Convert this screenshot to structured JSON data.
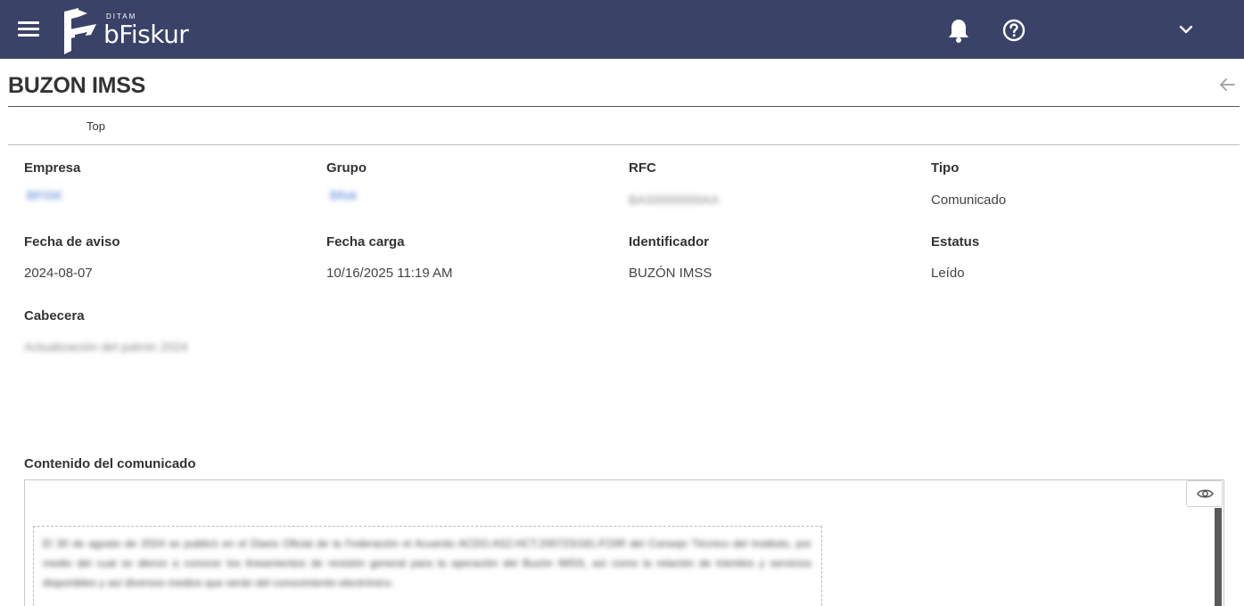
{
  "app": {
    "brand_small": "DITAM",
    "brand_name": "bFiskur",
    "colors": {
      "header_bg": "#3a4268",
      "link": "#4a7fd6"
    },
    "icons": {
      "menu": "hamburger-icon",
      "notifications": "bell-icon",
      "help": "help-circle-icon",
      "user_menu": "chevron-down-icon",
      "back": "arrow-left-icon",
      "preview": "eye-icon"
    }
  },
  "page": {
    "title": "BUZON IMSS",
    "breadcrumb": "Top"
  },
  "fields": {
    "empresa": {
      "label": "Empresa",
      "value": "BFISK"
    },
    "grupo": {
      "label": "Grupo",
      "value": "Bfisk"
    },
    "rfc": {
      "label": "RFC",
      "value": "BAS0000000AA"
    },
    "tipo": {
      "label": "Tipo",
      "value": "Comunicado"
    },
    "fecha_aviso": {
      "label": "Fecha de aviso",
      "value": "2024-08-07"
    },
    "fecha_carga": {
      "label": "Fecha carga",
      "value": "10/16/2025 11:19 AM"
    },
    "identificador": {
      "label": "Identificador",
      "value": "BUZÓN IMSS"
    },
    "estatus": {
      "label": "Estatus",
      "value": "Leído"
    },
    "cabecera": {
      "label": "Cabecera",
      "value": "Actualización del patrón 2024"
    }
  },
  "content": {
    "label": "Contenido del comunicado",
    "body": "El 30 de agosto de 2024 se publicó en el Diario Oficial de la Federación el Acuerdo ACDO.AS2.HCT.200723/181.P.DIR del Consejo Técnico del Instituto, por medio del cual se dieron a conocer los lineamientos de revisión general para la operación del Buzón IMSS, así como la relación de trámites y servicios disponibles y así diversos medios que serán del conocimiento electrónico."
  }
}
